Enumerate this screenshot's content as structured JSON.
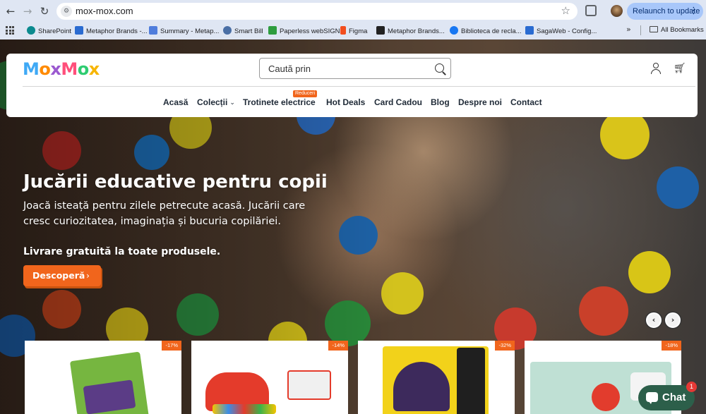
{
  "browser": {
    "url": "mox-mox.com",
    "relaunch_label": "Relaunch to update",
    "bookmarks": [
      {
        "label": "SharePoint",
        "color": "#0b8a8f"
      },
      {
        "label": "Metaphor Brands -...",
        "color": "#2a6bd1"
      },
      {
        "label": "Summary - Metap...",
        "color": "#4f7ddc"
      },
      {
        "label": "Smart Bill",
        "color": "#4a6fa5"
      },
      {
        "label": "Paperless webSIGN",
        "color": "#2e9d3f"
      },
      {
        "label": "Figma",
        "color": "#f24e1e"
      },
      {
        "label": "Metaphor Brands...",
        "color": "#222222"
      },
      {
        "label": "Biblioteca de recla...",
        "color": "#1877f2"
      },
      {
        "label": "SagaWeb - Config...",
        "color": "#2a6bd1"
      }
    ],
    "all_bookmarks_label": "All Bookmarks"
  },
  "header": {
    "logo": [
      "M",
      "o",
      "x",
      "M",
      "o",
      "x"
    ],
    "search_placeholder": "Caută prin",
    "menu": [
      {
        "label": "Acasă"
      },
      {
        "label": "Colecții"
      },
      {
        "label": "Trotinete electrice"
      },
      {
        "label": "Hot Deals"
      },
      {
        "label": "Card Cadou"
      },
      {
        "label": "Blog"
      },
      {
        "label": "Despre noi"
      },
      {
        "label": "Contact"
      }
    ],
    "menu_badge": "Reduceri"
  },
  "hero": {
    "title": "Jucării educative pentru copii",
    "subtitle": "Joacă isteață pentru zilele petrecute acasă. Jucării care cresc curiozitatea, imaginația și bucuria copilăriei.",
    "note": "Livrare gratuită la toate produsele.",
    "cta_label": "Descoperă"
  },
  "products": [
    {
      "discount": "-17%"
    },
    {
      "discount": "-14%"
    },
    {
      "discount": "-32%"
    },
    {
      "discount": "-18%"
    }
  ],
  "chat": {
    "label": "Chat",
    "count": "1"
  },
  "colors": {
    "accent": "#f1651c",
    "chat": "#2c5f4a"
  }
}
